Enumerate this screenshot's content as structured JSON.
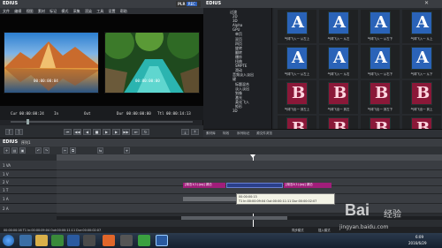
{
  "player": {
    "app_name": "EDIUS",
    "menu": [
      "文件",
      "编辑",
      "视图",
      "素材",
      "标记",
      "模式",
      "采集",
      "渲染",
      "工具",
      "设置",
      "帮助"
    ],
    "mode_label": "PLR",
    "mode_active": "REC",
    "left_timecode": "00:00:00:04",
    "right_timecode": "00:00:00:00",
    "cur_label": "Cur",
    "cur_value": "00:00:00:24",
    "in_label": "In",
    "out_label": "Out",
    "dur_label": "Dur",
    "dur_value": "00:00:00:00",
    "ttl_label": "Ttl",
    "ttl_value": "00:00:14:13"
  },
  "bin": {
    "app_name": "EDIUS",
    "tree": [
      "过渡",
      "2D",
      "3D",
      "Alpha",
      "GPU",
      "单页",
      "双页",
      "四页",
      "旋转",
      "翻转",
      "爆炸",
      "扭曲",
      "SMPTE",
      "滑动",
      "音频淡入淡出",
      "键",
      "标题混合",
      "淡入淡出",
      "划像",
      "激光",
      "柔化飞入",
      "矩形",
      "3D"
    ],
    "tab_labels": [
      "素材库",
      "特效",
      "序列标记",
      "源文件浏览"
    ],
    "thumbs": [
      {
        "letter": "A",
        "label": "气球飞入一 从左上",
        "style": "blue"
      },
      {
        "letter": "A",
        "label": "气球飞入一 从左",
        "style": "blue"
      },
      {
        "letter": "A",
        "label": "气球飞入一 从左下",
        "style": "blue"
      },
      {
        "letter": "A",
        "label": "气球飞入一 从上",
        "style": "blue"
      },
      {
        "letter": "A",
        "label": "气球飞入一 从左上",
        "style": "blue"
      },
      {
        "letter": "A",
        "label": "气球飞入一 从右",
        "style": "blue"
      },
      {
        "letter": "A",
        "label": "气球飞入一 从右下",
        "style": "blue"
      },
      {
        "letter": "A",
        "label": "气球飞入一 从下",
        "style": "blue"
      },
      {
        "letter": "B",
        "label": "气球飞出一 到左上",
        "style": "red"
      },
      {
        "letter": "B",
        "label": "气球飞出一 到左",
        "style": "red"
      },
      {
        "letter": "B",
        "label": "气球飞出一 到左下",
        "style": "red"
      },
      {
        "letter": "B",
        "label": "气球飞出一 到上",
        "style": "red"
      },
      {
        "letter": "B",
        "label": "气球飞出一 到右上",
        "style": "red"
      },
      {
        "letter": "B",
        "label": "气球飞出一 到右",
        "style": "red"
      },
      {
        "letter": "B",
        "label": "气球飞出一 到右下",
        "style": "red"
      },
      {
        "letter": "B",
        "label": "气球飞出一 到下",
        "style": "red"
      }
    ]
  },
  "timeline": {
    "app_name": "EDIUS",
    "sequence": "序列1",
    "tracks": [
      "1 VA",
      "1 V",
      "2 V",
      "1 T",
      "1 A",
      "2 A"
    ],
    "clips": [
      {
        "label": "[湖泊1(1).jpg] 湖泊",
        "color": "#a01e7a"
      },
      {
        "label": "[湖泊2(1).jpg] 湖泊",
        "color": "#a01e7a"
      }
    ],
    "tooltip_line1": "00:00:00:13",
    "tooltip_line2": "T1 In:00:00:09:04 Out:00:00:11:11 Dur:00:00:02:07",
    "status_left": "00:00:00:16  T1  In:00:00:09:04  Out:00:00:11:11  Dur:00:00:02:07",
    "status_right": "插入模式",
    "status_mid": "同步模式"
  },
  "taskbar": {
    "time": "6:09",
    "date": "2016/6/29"
  },
  "watermark": {
    "brand": "Bai",
    "sub": "经验",
    "url": "jingyan.baidu.com"
  }
}
